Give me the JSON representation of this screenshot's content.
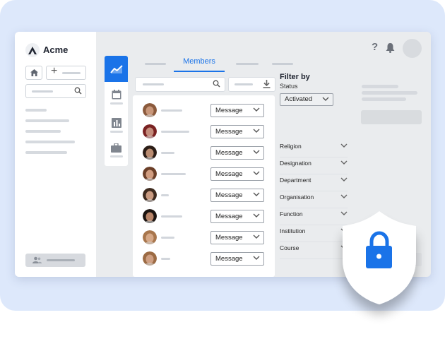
{
  "app": {
    "name": "Acme"
  },
  "tabs": {
    "active_label": "Members"
  },
  "members": {
    "action_label": "Message",
    "rows": [
      {
        "avatar_color": "#c9977a",
        "hair_color": "#8b5a3c"
      },
      {
        "avatar_color": "#c48d7c",
        "hair_color": "#7a2222"
      },
      {
        "avatar_color": "#b98b70",
        "hair_color": "#2b1d16"
      },
      {
        "avatar_color": "#d19d80",
        "hair_color": "#6b3f28"
      },
      {
        "avatar_color": "#c99a80",
        "hair_color": "#3e2a1e"
      },
      {
        "avatar_color": "#b88468",
        "hair_color": "#1c1410"
      },
      {
        "avatar_color": "#d6a887",
        "hair_color": "#a8764c"
      },
      {
        "avatar_color": "#cf9f82",
        "hair_color": "#9c6b44"
      }
    ]
  },
  "filter": {
    "title": "Filter by",
    "status_label": "Status",
    "status_value": "Activated",
    "facets": [
      "Religion",
      "Designation",
      "Department",
      "Organisation",
      "Function",
      "Institution",
      "Course"
    ]
  },
  "header": {
    "help_glyph": "?"
  },
  "colors": {
    "accent": "#1a73e8",
    "background_card": "#dde8fb"
  },
  "icons": [
    "acme-logo-icon",
    "home-icon",
    "plus-icon",
    "search-icon",
    "users-icon",
    "chart-line-icon",
    "calendar-icon",
    "bar-chart-icon",
    "briefcase-icon",
    "download-icon",
    "chevron-down-icon",
    "help-icon",
    "bell-icon",
    "shield-lock-icon"
  ]
}
